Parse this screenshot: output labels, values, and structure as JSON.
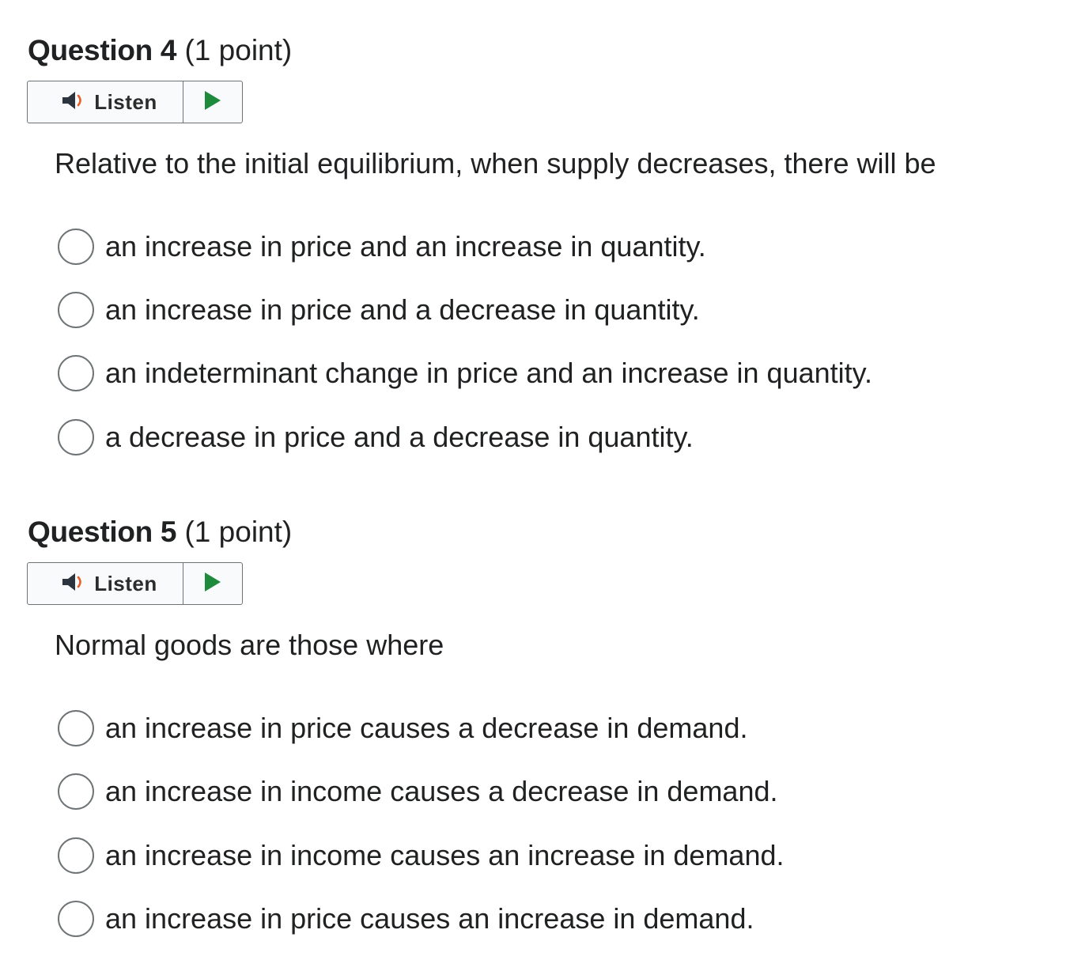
{
  "questions": [
    {
      "label": "Question 4",
      "points": "(1 point)",
      "listen_label": "Listen",
      "prompt": "Relative to the initial equilibrium, when supply decreases, there will be",
      "options": [
        "an increase in price and an increase in quantity.",
        "an increase in price and a decrease in quantity.",
        "an indeterminant change in price and an increase in quantity.",
        "a decrease in price and a decrease in quantity."
      ]
    },
    {
      "label": "Question 5",
      "points": "(1 point)",
      "listen_label": "Listen",
      "prompt": "Normal goods are those where",
      "options": [
        "an increase in price causes a decrease in demand.",
        "an increase in income causes a decrease in demand.",
        "an increase in income causes an increase in demand.",
        "an increase in price causes an increase in demand."
      ]
    }
  ],
  "colors": {
    "speaker_icon": "#2c3440",
    "sound_waves": "#e5632a",
    "play_icon": "#1e8a3c",
    "radio_border": "#6e7376",
    "text": "#202122"
  },
  "icons": {
    "listen": "speaker-icon",
    "play": "play-icon"
  }
}
